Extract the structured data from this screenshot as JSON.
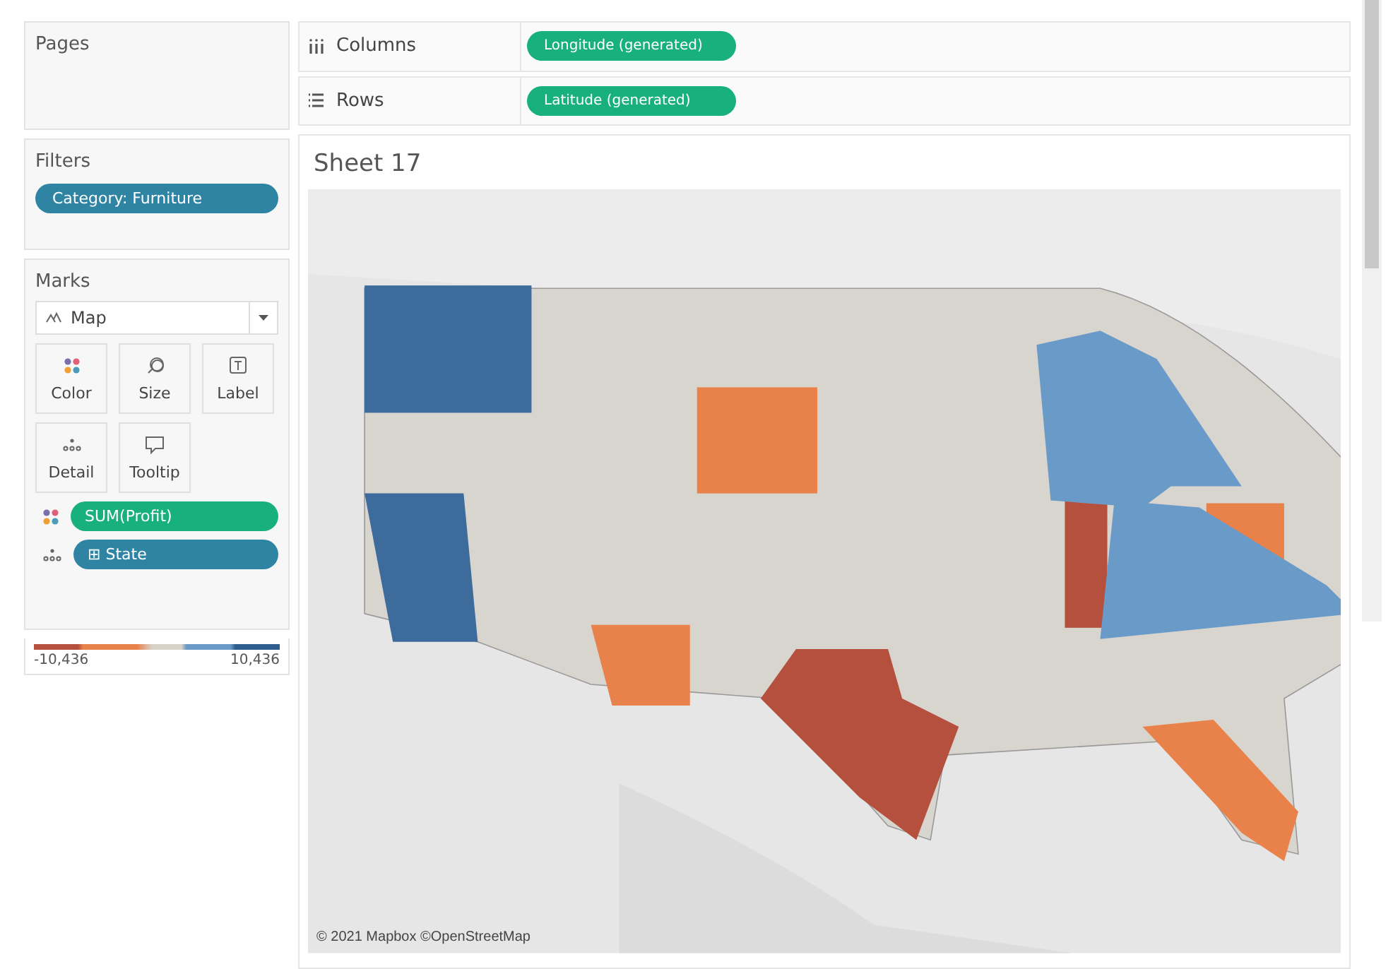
{
  "pages": {
    "title": "Pages"
  },
  "filters": {
    "title": "Filters",
    "pills": [
      {
        "label": "Category: Furniture",
        "kind": "dimension"
      }
    ]
  },
  "marks": {
    "title": "Marks",
    "mark_type": "Map",
    "cards": [
      {
        "label": "Color",
        "kind": "color"
      },
      {
        "label": "Size",
        "kind": "size"
      },
      {
        "label": "Label",
        "kind": "label"
      },
      {
        "label": "Detail",
        "kind": "detail"
      },
      {
        "label": "Tooltip",
        "kind": "tooltip"
      }
    ],
    "fields": [
      {
        "label": "SUM(Profit)",
        "kind": "measure"
      },
      {
        "label": "⊞ State",
        "kind": "dimension"
      }
    ]
  },
  "legend": {
    "min": "-10,436",
    "max": "10,436"
  },
  "shelves": [
    {
      "label": "Columns",
      "kind": "columns",
      "pill": "Longitude (generated)"
    },
    {
      "label": "Rows",
      "kind": "rows",
      "pill": "Latitude (generated)"
    }
  ],
  "sheet": {
    "title": "Sheet 17",
    "map": {
      "kind": "picture",
      "attribution": "© 2021 Mapbox ©OpenStreetMap"
    }
  }
}
